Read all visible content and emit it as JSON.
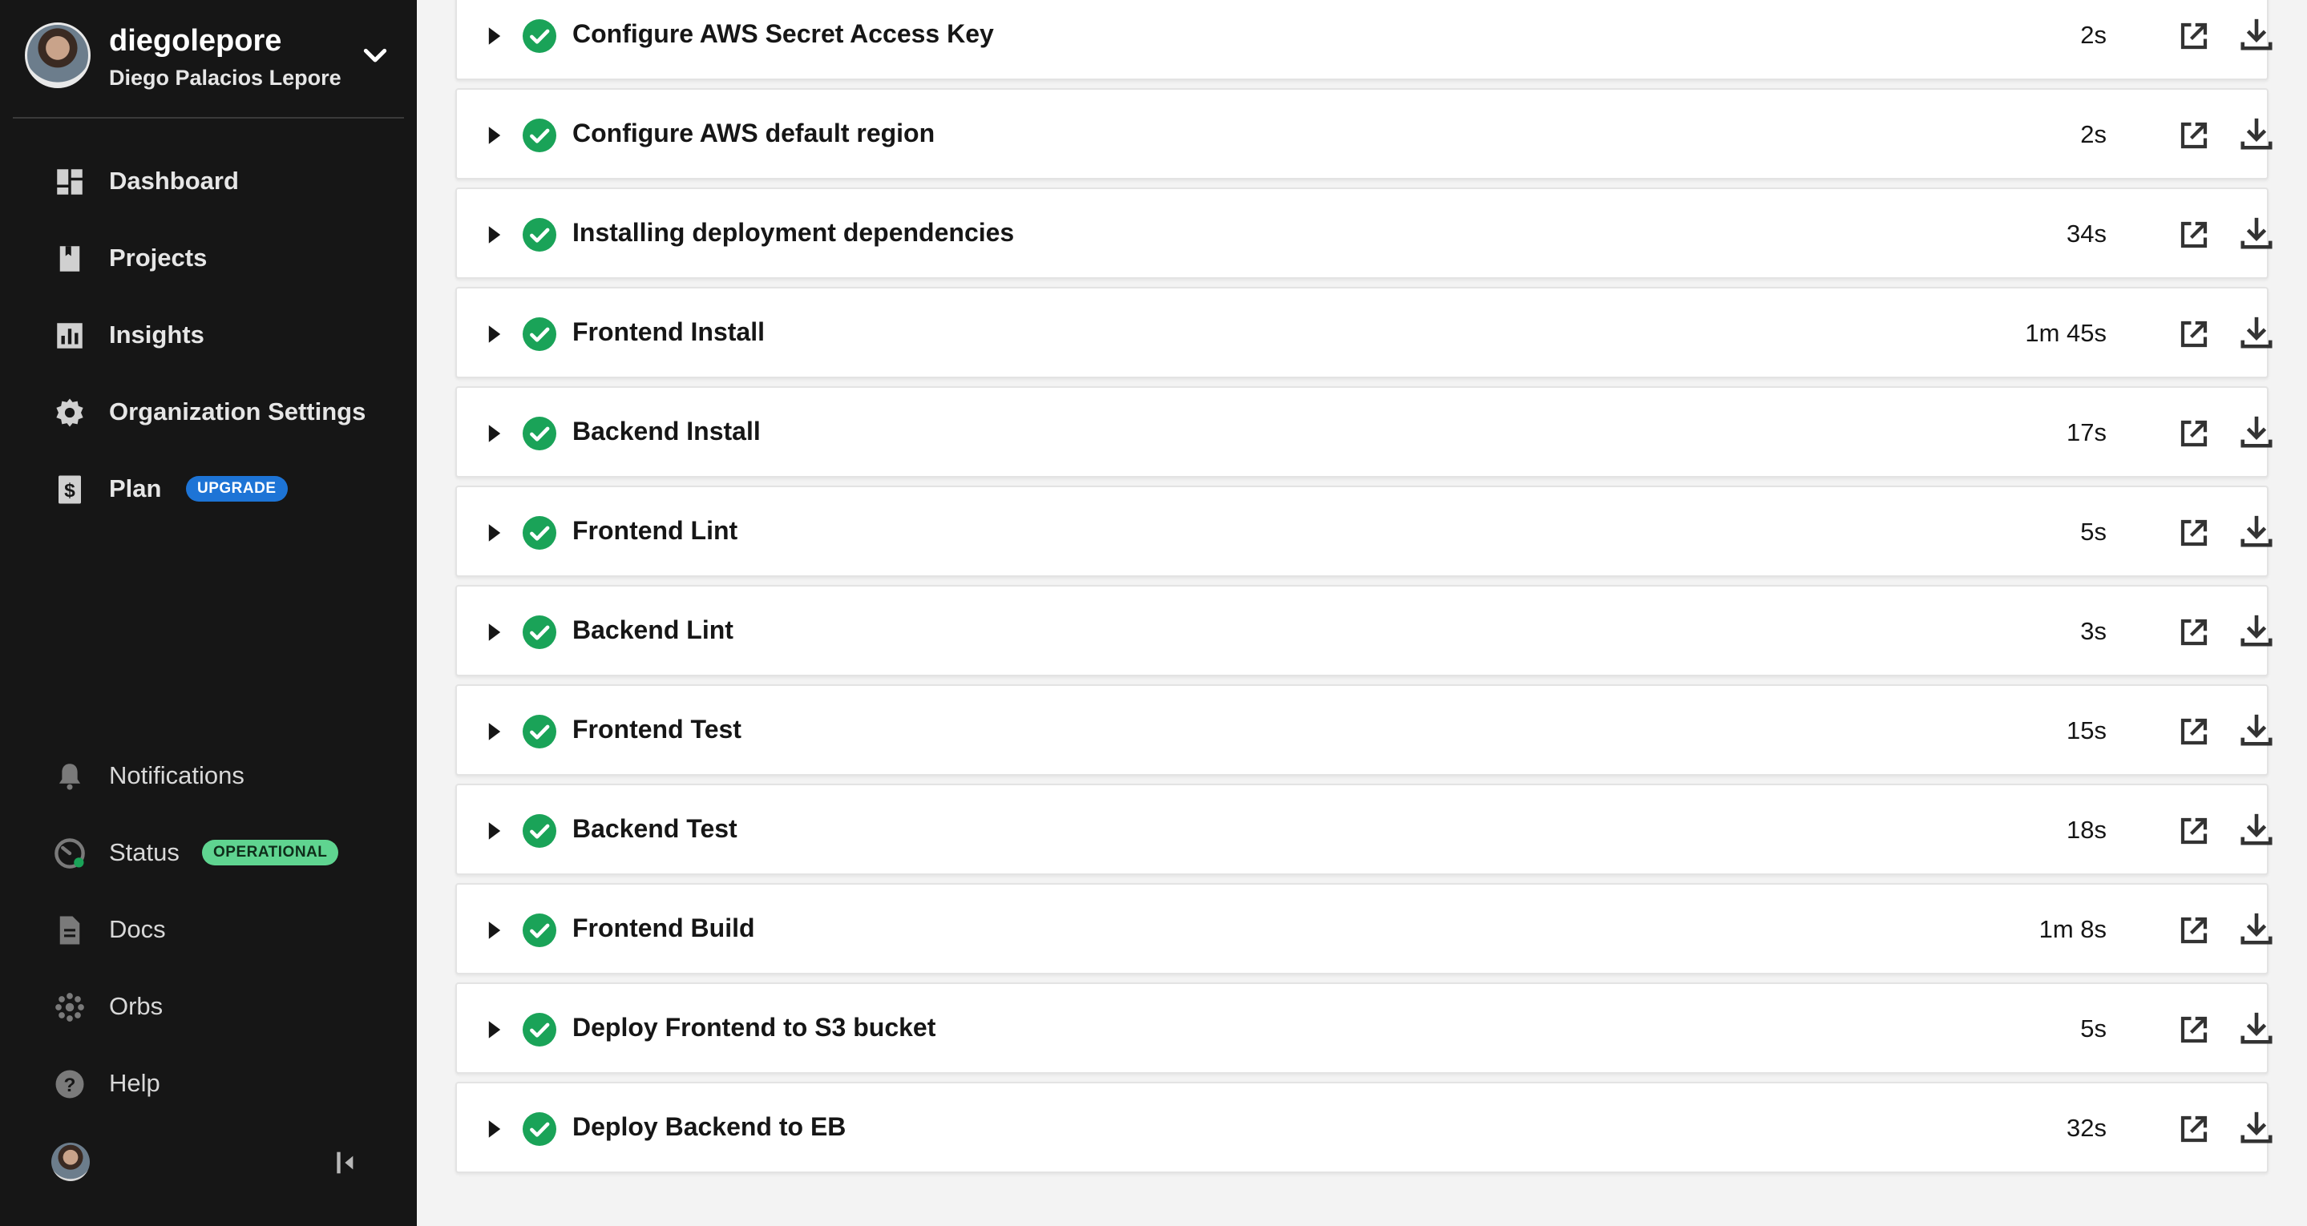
{
  "org": {
    "name": "diegolepore",
    "full_name": "Diego Palacios Lepore"
  },
  "nav": {
    "dashboard": "Dashboard",
    "projects": "Projects",
    "insights": "Insights",
    "org_settings": "Organization Settings",
    "plan": "Plan",
    "plan_badge": "UPGRADE",
    "notifications": "Notifications",
    "status": "Status",
    "status_badge": "OPERATIONAL",
    "docs": "Docs",
    "orbs": "Orbs",
    "help": "Help"
  },
  "colors": {
    "sidebar_bg": "#161616",
    "success_green": "#1aa358",
    "upgrade_blue": "#1d74d6",
    "operational_green": "#5fd490"
  },
  "steps": [
    {
      "name": "Configure AWS Secret Access Key",
      "duration": "2s"
    },
    {
      "name": "Configure AWS default region",
      "duration": "2s"
    },
    {
      "name": "Installing deployment dependencies",
      "duration": "34s"
    },
    {
      "name": "Frontend Install",
      "duration": "1m 45s"
    },
    {
      "name": "Backend Install",
      "duration": "17s"
    },
    {
      "name": "Frontend Lint",
      "duration": "5s"
    },
    {
      "name": "Backend Lint",
      "duration": "3s"
    },
    {
      "name": "Frontend Test",
      "duration": "15s"
    },
    {
      "name": "Backend Test",
      "duration": "18s"
    },
    {
      "name": "Frontend Build",
      "duration": "1m 8s"
    },
    {
      "name": "Deploy Frontend to S3 bucket",
      "duration": "5s"
    },
    {
      "name": "Deploy Backend to EB",
      "duration": "32s"
    }
  ],
  "icons": {
    "step_status": "check-circle-icon",
    "step_expand": "caret-right-icon",
    "step_open": "open-external-icon",
    "step_download": "download-icon"
  }
}
